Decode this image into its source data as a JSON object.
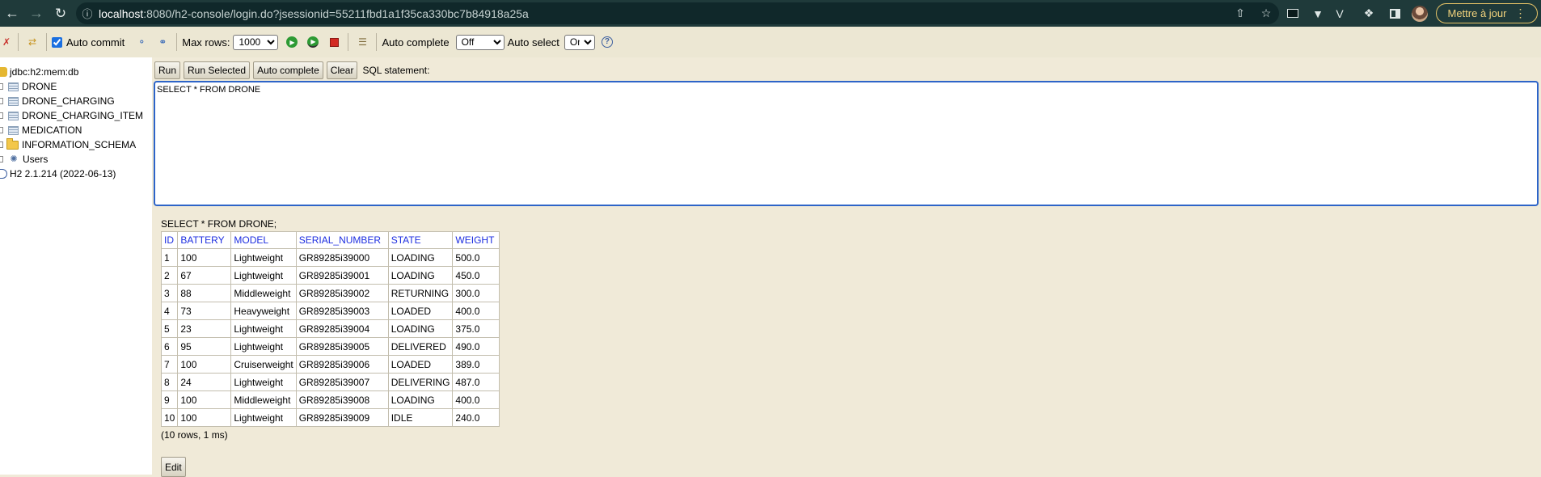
{
  "browser": {
    "url_host": "localhost",
    "url_rest": ":8080/h2-console/login.do?jsessionid=55211fbd1a1f35ca330bc7b84918a25a",
    "update_label": "Mettre à jour"
  },
  "toolbar": {
    "auto_commit_label": "Auto commit",
    "auto_commit_checked": true,
    "max_rows_label": "Max rows:",
    "max_rows_value": "1000",
    "auto_complete_label": "Auto complete",
    "auto_complete_value": "Off",
    "auto_select_label": "Auto select",
    "auto_select_value": "On",
    "help_glyph": "?"
  },
  "tree": {
    "connection": "jdbc:h2:mem:db",
    "tables": [
      "DRONE",
      "DRONE_CHARGING",
      "DRONE_CHARGING_ITEM",
      "MEDICATION"
    ],
    "schema": "INFORMATION_SCHEMA",
    "users": "Users",
    "version": "H2 2.1.214 (2022-06-13)"
  },
  "query": {
    "run_label": "Run",
    "run_selected_label": "Run Selected",
    "auto_complete_label": "Auto complete",
    "clear_label": "Clear",
    "statement_label": "SQL statement:",
    "sql_text": "SELECT * FROM DRONE"
  },
  "result": {
    "title": "SELECT * FROM DRONE;",
    "columns": [
      "ID",
      "BATTERY",
      "MODEL",
      "SERIAL_NUMBER",
      "STATE",
      "WEIGHT"
    ],
    "rows": [
      [
        "1",
        "100",
        "Lightweight",
        "GR89285i39000",
        "LOADING",
        "500.0"
      ],
      [
        "2",
        "67",
        "Lightweight",
        "GR89285i39001",
        "LOADING",
        "450.0"
      ],
      [
        "3",
        "88",
        "Middleweight",
        "GR89285i39002",
        "RETURNING",
        "300.0"
      ],
      [
        "4",
        "73",
        "Heavyweight",
        "GR89285i39003",
        "LOADED",
        "400.0"
      ],
      [
        "5",
        "23",
        "Lightweight",
        "GR89285i39004",
        "LOADING",
        "375.0"
      ],
      [
        "6",
        "95",
        "Lightweight",
        "GR89285i39005",
        "DELIVERED",
        "490.0"
      ],
      [
        "7",
        "100",
        "Cruiserweight",
        "GR89285i39006",
        "LOADED",
        "389.0"
      ],
      [
        "8",
        "24",
        "Lightweight",
        "GR89285i39007",
        "DELIVERING",
        "487.0"
      ],
      [
        "9",
        "100",
        "Middleweight",
        "GR89285i39008",
        "LOADING",
        "400.0"
      ],
      [
        "10",
        "100",
        "Lightweight",
        "GR89285i39009",
        "IDLE",
        "240.0"
      ]
    ],
    "footer": "(10 rows, 1 ms)",
    "edit_label": "Edit"
  }
}
